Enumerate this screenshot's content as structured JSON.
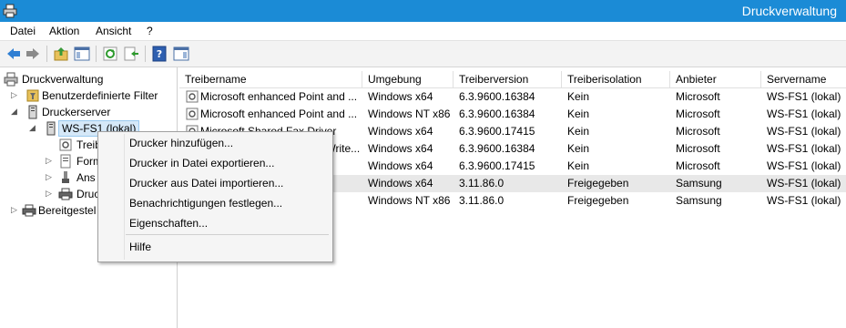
{
  "window": {
    "title": "Druckverwaltung"
  },
  "menu": [
    "Datei",
    "Aktion",
    "Ansicht",
    "?"
  ],
  "toolbar": {
    "buttons": [
      "back-icon",
      "forward-icon",
      "up-folder-icon",
      "show-hide-console-tree-icon",
      "refresh-icon",
      "export-list-icon",
      "help-icon",
      "show-hide-action-pane-icon"
    ]
  },
  "tree": {
    "root": "Druckverwaltung",
    "filters": "Benutzerdefinierte Filter",
    "servers": "Druckerserver",
    "server": "WS-FS1 (lokal)",
    "child_drivers": "Treib",
    "child_forms": "Form",
    "child_ports": "Ans",
    "child_printers": "Druc",
    "deployed": "Bereitgestel"
  },
  "columns": [
    "Treibername",
    "Umgebung",
    "Treiberversion",
    "Treiberisolation",
    "Anbieter",
    "Servername"
  ],
  "rows": [
    {
      "name": "Microsoft enhanced Point and ...",
      "env": "Windows x64",
      "version": "6.3.9600.16384",
      "isolation": "Kein",
      "vendor": "Microsoft",
      "server": "WS-FS1 (lokal)"
    },
    {
      "name": "Microsoft enhanced Point and ...",
      "env": "Windows NT x86",
      "version": "6.3.9600.16384",
      "isolation": "Kein",
      "vendor": "Microsoft",
      "server": "WS-FS1 (lokal)"
    },
    {
      "name": "Microsoft Shared Fax Driver",
      "env": "Windows x64",
      "version": "6.3.9600.17415",
      "isolation": "Kein",
      "vendor": "Microsoft",
      "server": "WS-FS1 (lokal)"
    },
    {
      "name": "Microsoft XPS Document Write...",
      "env": "Windows x64",
      "version": "6.3.9600.16384",
      "isolation": "Kein",
      "vendor": "Microsoft",
      "server": "WS-FS1 (lokal)"
    },
    {
      "name": "",
      "env": "Windows x64",
      "version": "6.3.9600.17415",
      "isolation": "Kein",
      "vendor": "Microsoft",
      "server": "WS-FS1 (lokal)"
    },
    {
      "name": "",
      "env": "Windows x64",
      "version": "3.11.86.0",
      "isolation": "Freigegeben",
      "vendor": "Samsung",
      "server": "WS-FS1 (lokal)"
    },
    {
      "name": "",
      "env": "Windows NT x86",
      "version": "3.11.86.0",
      "isolation": "Freigegeben",
      "vendor": "Samsung",
      "server": "WS-FS1 (lokal)"
    }
  ],
  "context_menu": {
    "add_printer": "Drucker hinzufügen...",
    "export": "Drucker in Datei exportieren...",
    "import": "Drucker aus Datei importieren...",
    "notifications": "Benachrichtigungen festlegen...",
    "properties": "Eigenschaften...",
    "help": "Hilfe"
  }
}
